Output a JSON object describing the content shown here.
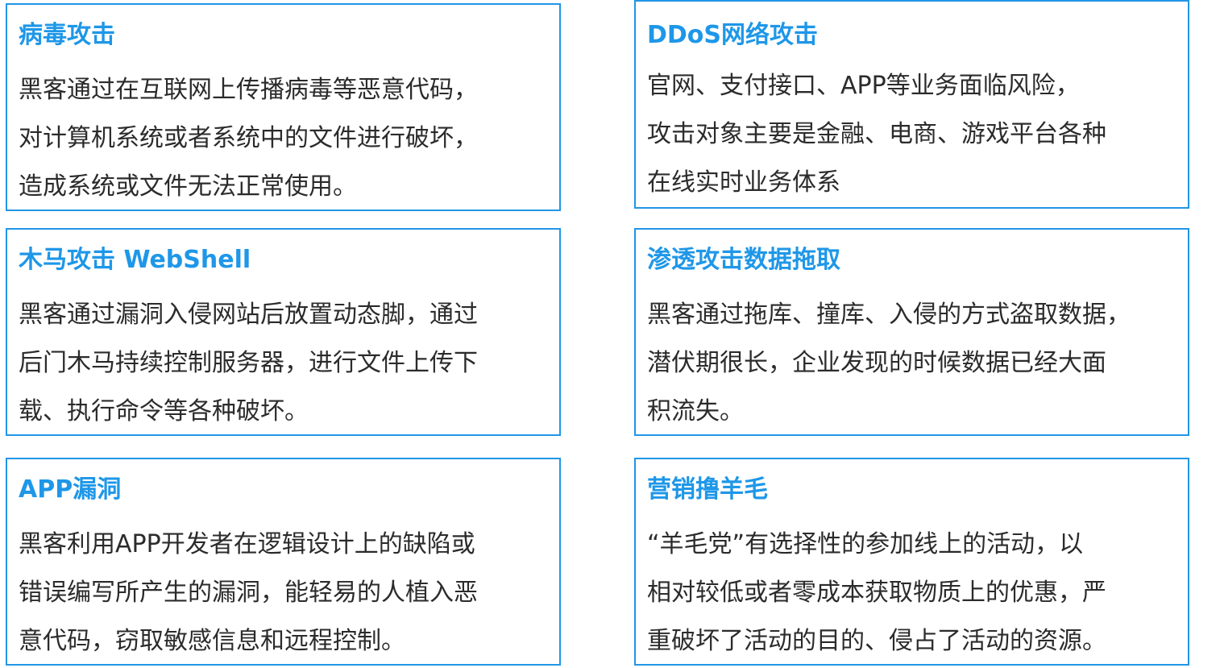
{
  "cards": [
    {
      "title": "病毒攻击",
      "lines": [
        "黑客通过在互联网上传播病毒等恶意代码，",
        "对计算机系统或者系统中的文件进行破坏，",
        "造成系统或文件无法正常使用。"
      ]
    },
    {
      "title": "DDoS网络攻击",
      "lines": [
        "官网、支付接口、APP等业务面临风险，",
        "攻击对象主要是金融、电商、游戏平台各种",
        "在线实时业务体系"
      ]
    },
    {
      "title": "木马攻击 WebShell",
      "lines": [
        "黑客通过漏洞入侵网站后放置动态脚，通过",
        "后门木马持续控制服务器，进行文件上传下",
        "载、执行命令等各种破坏。"
      ]
    },
    {
      "title": "渗透攻击数据拖取",
      "lines": [
        "黑客通过拖库、撞库、入侵的方式盗取数据，",
        "潜伏期很长，企业发现的时候数据已经大面",
        "积流失。"
      ]
    },
    {
      "title": "APP漏洞",
      "lines": [
        "黑客利用APP开发者在逻辑设计上的缺陷或",
        "错误编写所产生的漏洞，能轻易的人植入恶",
        "意代码，窃取敏感信息和远程控制。"
      ]
    },
    {
      "title": "营销撸羊毛",
      "lines": [
        "“羊毛党”有选择性的参加线上的活动，以",
        "相对较低或者零成本获取物质上的优惠，严",
        "重破坏了活动的目的、侵占了活动的资源。"
      ]
    }
  ],
  "colors": {
    "border": "#2196E6",
    "title": "#1E97E8",
    "body": "#2b2b2b"
  }
}
